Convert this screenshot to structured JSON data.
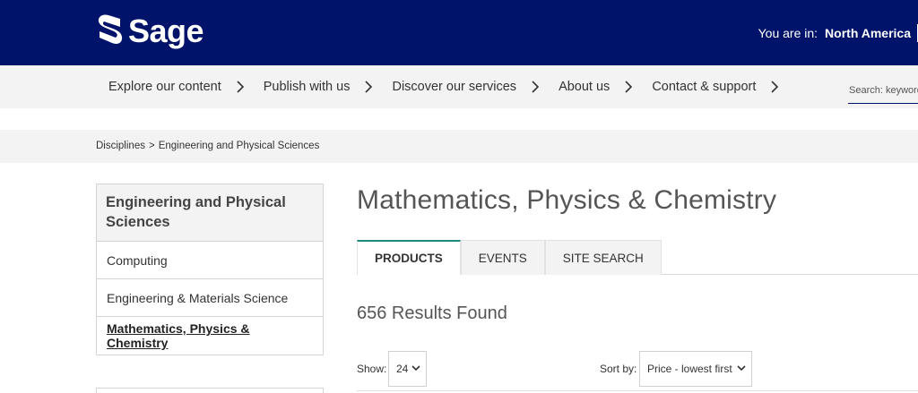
{
  "header": {
    "logo_text": "Sage",
    "region_label": "You are in:",
    "region_value": "North America"
  },
  "nav": {
    "items": [
      {
        "label": "Explore our content"
      },
      {
        "label": "Publish with us"
      },
      {
        "label": "Discover our services"
      },
      {
        "label": "About us"
      },
      {
        "label": "Contact & support"
      }
    ],
    "search_placeholder": "Search: keywords"
  },
  "breadcrumb": {
    "root": "Disciplines",
    "separator": ">",
    "current": "Engineering and Physical Sciences"
  },
  "sidebar": {
    "heading": "Engineering and Physical Sciences",
    "items": [
      {
        "label": "Computing",
        "active": false
      },
      {
        "label": "Engineering & Materials Science",
        "active": false
      },
      {
        "label": "Mathematics, Physics & Chemistry",
        "active": true
      }
    ]
  },
  "main": {
    "title": "Mathematics, Physics & Chemistry",
    "tabs": [
      {
        "label": "PRODUCTS",
        "active": true
      },
      {
        "label": "EVENTS",
        "active": false
      },
      {
        "label": "SITE SEARCH",
        "active": false
      }
    ],
    "results_text": "656 Results Found",
    "show_label": "Show:",
    "show_value": "24",
    "sort_label": "Sort by:",
    "sort_value": "Price - lowest first"
  },
  "colors": {
    "header_bg": "#00136b",
    "nav_bg": "#f3f3f3",
    "tab_accent": "#1b8a82"
  }
}
